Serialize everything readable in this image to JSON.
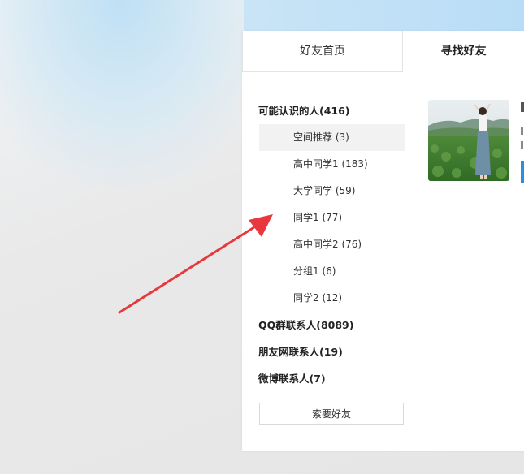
{
  "tabs": {
    "home_label": "好友首页",
    "find_label": "寻找好友"
  },
  "sidebar": {
    "groups": [
      {
        "label": "可能认识的人(416)",
        "items": [
          {
            "label": "空间推荐 (3)"
          },
          {
            "label": "高中同学1 (183)"
          },
          {
            "label": "大学同学 (59)"
          },
          {
            "label": "同学1 (77)"
          },
          {
            "label": "高中同学2 (76)"
          },
          {
            "label": "分组1 (6)"
          },
          {
            "label": "同学2 (12)"
          }
        ]
      },
      {
        "label": "QQ群联系人(8089)"
      },
      {
        "label": "朋友网联系人(19)"
      },
      {
        "label": "微博联系人(7)"
      }
    ],
    "invite_label": "索要好友"
  },
  "colors": {
    "arrow": "#e8383d",
    "accent": "#2d8ee0"
  },
  "icons": {
    "arrow": "annotation-arrow-icon",
    "photo": "profile-photo"
  }
}
